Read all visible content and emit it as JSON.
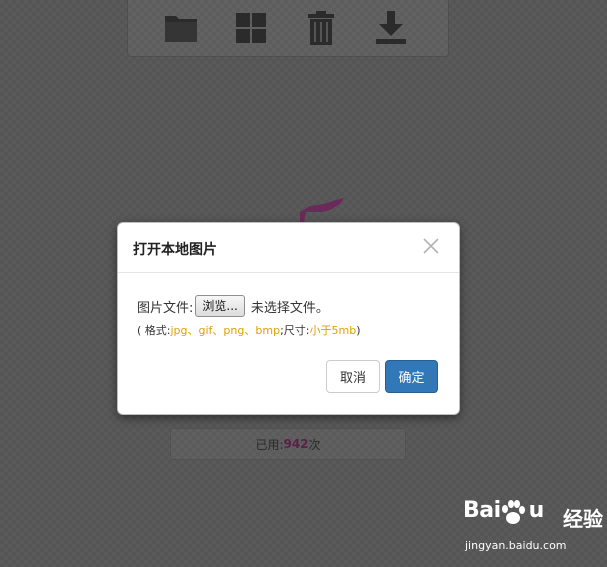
{
  "toolbar": {
    "buttons": [
      {
        "name": "folder-icon"
      },
      {
        "name": "grid-icon"
      },
      {
        "name": "trash-icon"
      },
      {
        "name": "download-icon"
      }
    ]
  },
  "usage": {
    "prefix": "已用:",
    "count": "942",
    "suffix": "次"
  },
  "modal": {
    "title": "打开本地图片",
    "close_icon": "close-icon",
    "file_label": "图片文件:",
    "browse_label": "浏览...",
    "no_file_text": "未选择文件。",
    "hint": {
      "open": "( 格式:",
      "formats": "jpg、gif、png、bmp",
      "sep": ";尺寸:",
      "size": "小于5mb",
      "close": ")"
    },
    "cancel_label": "取消",
    "ok_label": "确定"
  },
  "colors": {
    "primary_button": "#3278b8",
    "hint_highlight": "#e0a000",
    "count_color": "#5a2148"
  },
  "watermark": {
    "logo": "Bai",
    "logo_tail": "u",
    "sub": "经验",
    "url": "jingyan.baidu.com"
  }
}
